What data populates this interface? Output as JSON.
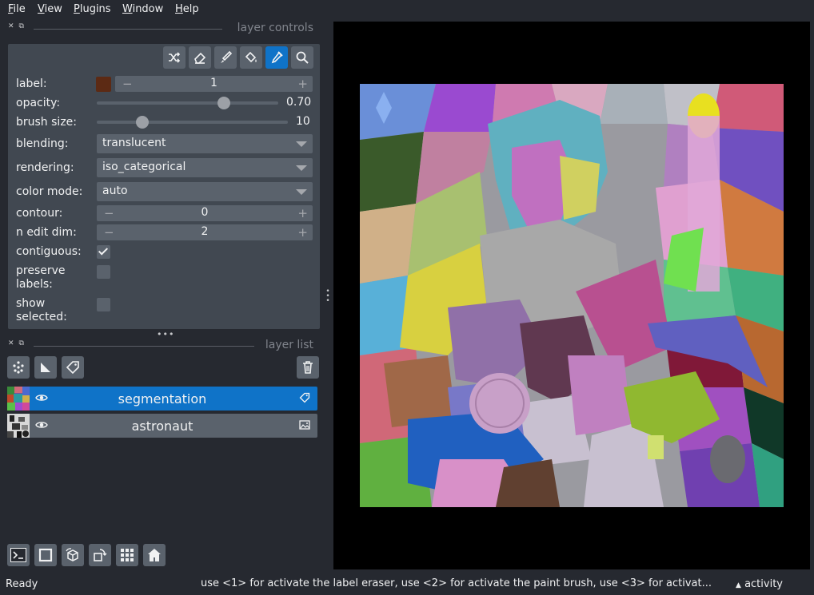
{
  "menubar": {
    "items": [
      {
        "first": "F",
        "rest": "ile"
      },
      {
        "first": "V",
        "rest": "iew"
      },
      {
        "first": "P",
        "rest": "lugins"
      },
      {
        "first": "W",
        "rest": "indow"
      },
      {
        "first": "H",
        "rest": "elp"
      }
    ]
  },
  "layer_controls": {
    "title": "layer controls",
    "tools": [
      "shuffle-icon",
      "eraser-icon",
      "paint-brush-icon",
      "fill-bucket-icon",
      "color-picker-icon",
      "zoom-icon"
    ],
    "active_tool": "color-picker-icon",
    "label": {
      "text": "label:",
      "value": "1",
      "color": "#5c2a14"
    },
    "opacity": {
      "text": "opacity:",
      "value": "0.70",
      "fraction": 0.7
    },
    "brush_size": {
      "text": "brush size:",
      "value": "10",
      "fraction": 0.24
    },
    "blending": {
      "text": "blending:",
      "value": "translucent"
    },
    "rendering": {
      "text": "rendering:",
      "value": "iso_categorical"
    },
    "color_mode": {
      "text": "color mode:",
      "value": "auto"
    },
    "contour": {
      "text": "contour:",
      "value": "0"
    },
    "n_edit_dim": {
      "text": "n edit dim:",
      "value": "2"
    },
    "contiguous": {
      "text": "contiguous:",
      "checked": true
    },
    "preserve_labels": {
      "text_line1": "preserve",
      "text_line2": "labels:",
      "checked": false
    },
    "show_selected": {
      "text_line1": "show",
      "text_line2": "selected:",
      "checked": false
    }
  },
  "layer_list": {
    "title": "layer list",
    "layers": [
      {
        "name": "segmentation",
        "selected": true,
        "type_icon": "label-tag-icon"
      },
      {
        "name": "astronaut",
        "selected": false,
        "type_icon": "image-icon"
      }
    ]
  },
  "bottom_toolbar": [
    "console-icon",
    "2d-3d-toggle-icon",
    "roll-dims-icon",
    "transpose-icon",
    "grid-icon",
    "home-icon"
  ],
  "status": {
    "ready": "Ready",
    "hint": "use <1> for activate the label eraser, use <2> for activate the paint brush, use <3> for activat...",
    "activity": "activity"
  },
  "colors": {
    "accent": "#0f73c8",
    "background": "#262930",
    "panel": "#414851"
  }
}
